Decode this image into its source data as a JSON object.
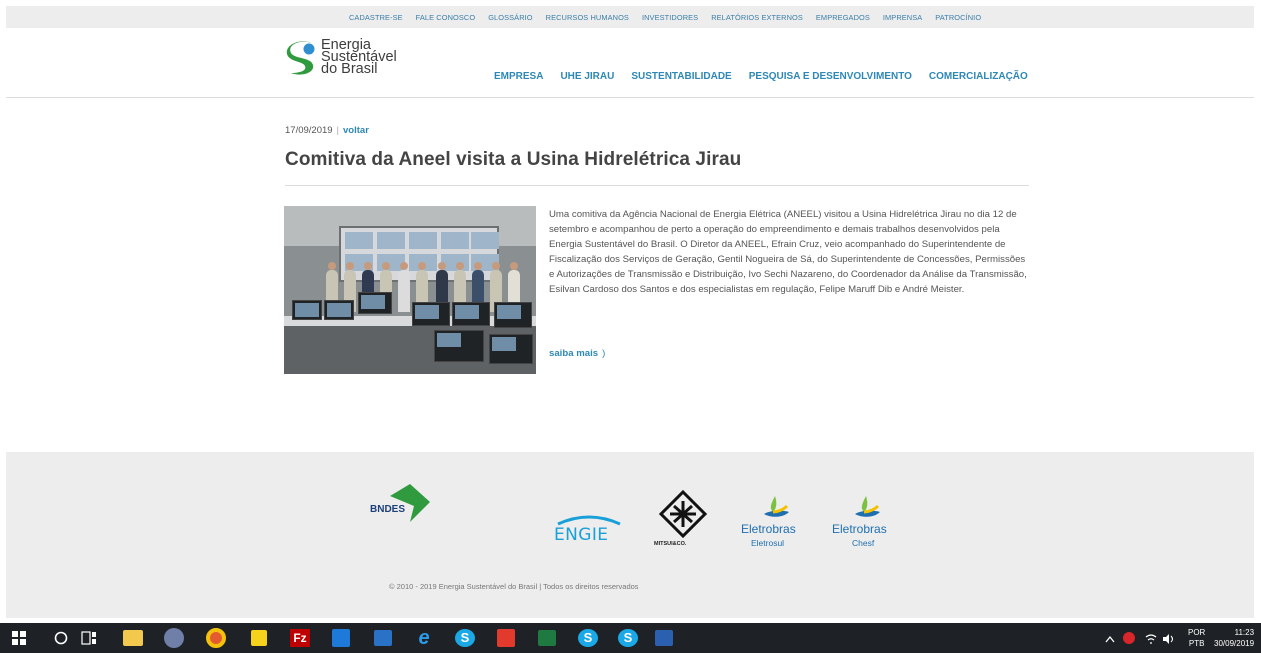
{
  "topbar": {
    "links": [
      "CADASTRE-SE",
      "FALE CONOSCO",
      "GLOSSÁRIO",
      "RECURSOS HUMANOS",
      "INVESTIDORES",
      "RELATÓRIOS EXTERNOS",
      "EMPREGADOS",
      "IMPRENSA",
      "PATROCÍNIO"
    ]
  },
  "logo": {
    "line1": "Energia",
    "line2": "Sustentável",
    "line3": "do Brasil"
  },
  "nav": {
    "items": [
      "EMPRESA",
      "UHE JIRAU",
      "SUSTENTABILIDADE",
      "PESQUISA E DESENVOLVIMENTO",
      "COMERCIALIZAÇÃO"
    ]
  },
  "article": {
    "date": "17/09/2019",
    "separator": "|",
    "back_label": "voltar",
    "title": "Comitiva da Aneel visita a Usina Hidrelétrica Jirau",
    "body": "Uma comitiva da Agência Nacional de Energia Elétrica (ANEEL) visitou a Usina Hidrelétrica Jirau no dia 12 de setembro e acompanhou de perto a operação do empreendimento e demais trabalhos desenvolvidos pela Energia Sustentável do Brasil. O Diretor da ANEEL, Efrain Cruz, veio acompanhado do Superintendente de Fiscalização dos Serviços de Geração, Gentil Nogueira de Sá, do Superintendente de Concessões, Permissões e Autorizações de Transmissão e Distribuição, Ivo Sechi Nazareno, do Coordenador da Análise da Transmissão, Esilvan Cardoso dos Santos e dos especialistas em regulação, Felipe Maruff Dib e André Meister.",
    "read_more": "saiba mais",
    "read_more_chevron": ")"
  },
  "footer": {
    "partners": {
      "bndes": "BNDES",
      "engie": "ENGIE",
      "mitsui": "MITSUI&CO.",
      "eletrosul_name": "Eletrobras",
      "eletrosul_sub": "Eletrosul",
      "chesf_name": "Eletrobras",
      "chesf_sub": "Chesf"
    },
    "copyright": "© 2010 - 2019 Energia Sustentável do Brasil | Todos os direitos reservados"
  },
  "taskbar": {
    "lang_top": "POR",
    "lang_bottom": "PTB",
    "time": "11:23",
    "date": "30/09/2019"
  },
  "colors": {
    "link_blue": "#2e88b5",
    "taskbar": "#1e2226",
    "footer_bg": "#ededed"
  }
}
